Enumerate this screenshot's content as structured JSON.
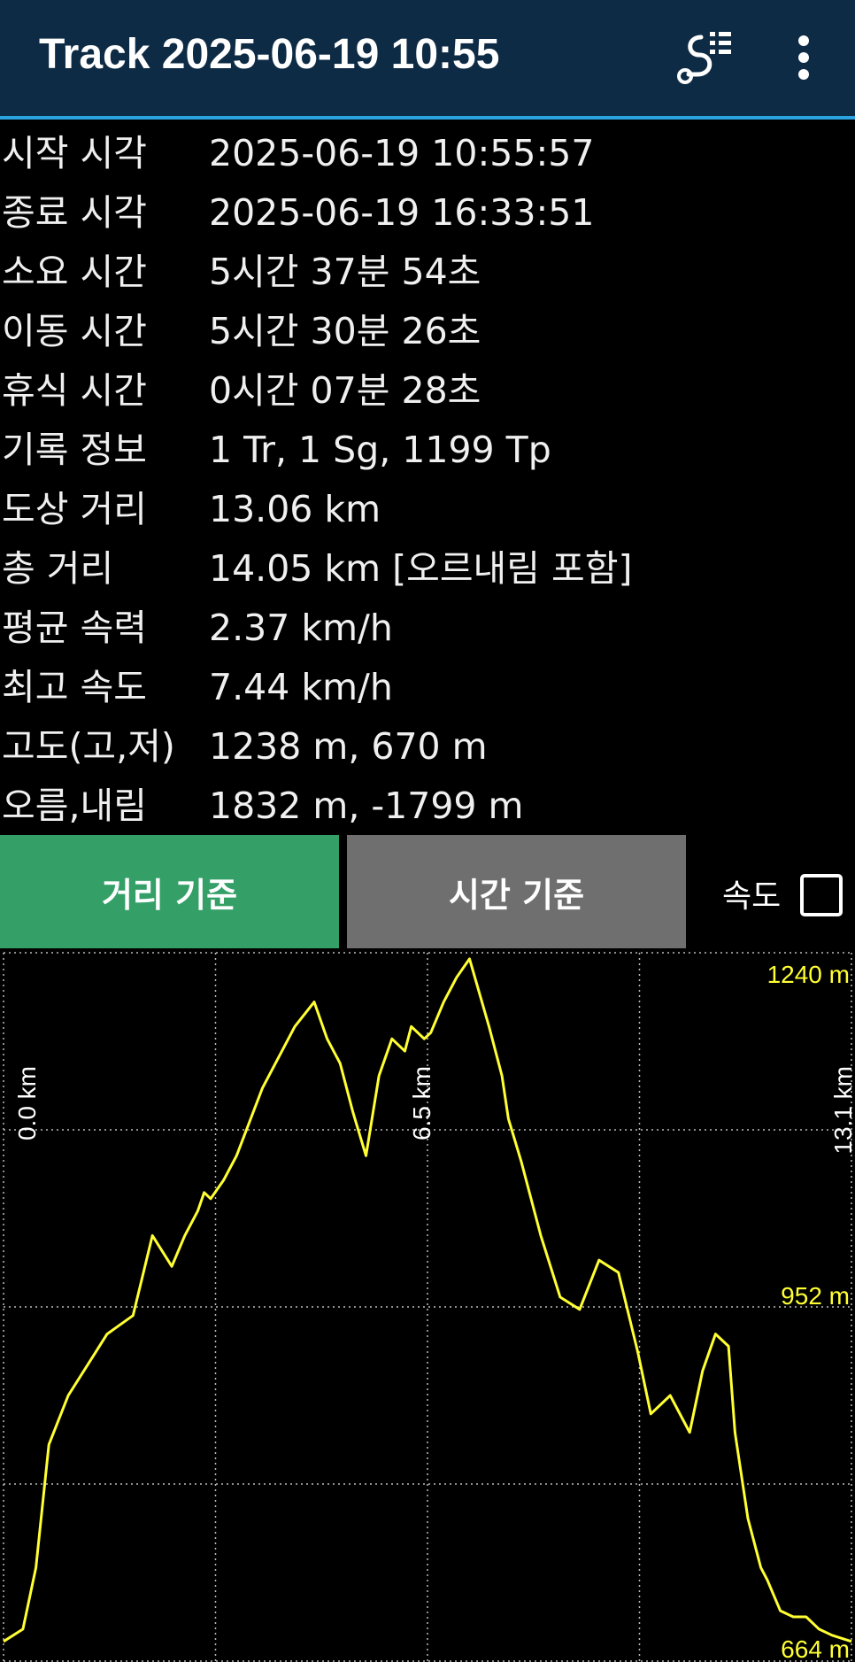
{
  "appbar": {
    "title": "Track 2025-06-19 10:55",
    "route_icon": "route-list-icon",
    "menu_icon": "more-vert-icon"
  },
  "info_rows": [
    {
      "label": "시작 시각",
      "value": "2025-06-19 10:55:57"
    },
    {
      "label": "종료 시각",
      "value": "2025-06-19 16:33:51"
    },
    {
      "label": "소요 시간",
      "value": "5시간 37분 54초"
    },
    {
      "label": "이동 시간",
      "value": "5시간 30분 26초"
    },
    {
      "label": "휴식 시간",
      "value": "0시간 07분 28초"
    },
    {
      "label": "기록 정보",
      "value": "1 Tr, 1 Sg, 1199 Tp"
    },
    {
      "label": "도상 거리",
      "value": "13.06 km"
    },
    {
      "label": "총 거리",
      "value": "14.05 km [오르내림 포함]"
    },
    {
      "label": "평균 속력",
      "value": "2.37 km/h"
    },
    {
      "label": "최고 속도",
      "value": "7.44 km/h"
    },
    {
      "label": "고도(고,저)",
      "value": "1238 m, 670 m"
    },
    {
      "label": "오름,내림",
      "value": "1832 m, -1799 m"
    }
  ],
  "buttons": {
    "distance_label": "거리 기준",
    "time_label": "시간 기준",
    "speed_label": "속도",
    "speed_checked": false
  },
  "colors": {
    "appbar_bg": "#0e2b45",
    "appbar_accent": "#2aa3e0",
    "active_button": "#34a068",
    "inactive_button": "#6f6f6f",
    "line": "#ffff33"
  },
  "chart_data": {
    "type": "line",
    "xlabel": "",
    "ylabel": "",
    "x_labels": [
      "0.0 km",
      "6.5 km",
      "13.1 km"
    ],
    "y_labels": [
      "1240 m",
      "952 m",
      "664 m"
    ],
    "xlim": [
      0,
      13.1
    ],
    "ylim": [
      664,
      1240
    ],
    "grid": true,
    "series": [
      {
        "x": [
          0,
          0.3,
          0.5,
          0.7,
          1.0,
          1.3,
          1.6,
          2.0,
          2.3,
          2.6,
          2.8,
          3.0,
          3.1,
          3.2,
          3.4,
          3.6,
          4.0,
          4.3,
          4.5,
          4.8,
          5.0,
          5.2,
          5.4,
          5.6,
          5.8,
          6.0,
          6.2,
          6.3,
          6.5,
          6.6,
          6.8,
          7.0,
          7.2,
          7.5,
          7.7,
          7.8,
          8.0,
          8.3,
          8.6,
          8.9,
          9.2,
          9.5,
          9.8,
          10.0,
          10.3,
          10.6,
          10.8,
          11.0,
          11.2,
          11.3,
          11.5,
          11.7,
          11.8,
          12.0,
          12.2,
          12.4,
          12.6,
          12.8,
          13.1
        ],
        "values": [
          680,
          690,
          740,
          840,
          880,
          905,
          930,
          945,
          1010,
          985,
          1010,
          1030,
          1045,
          1040,
          1055,
          1075,
          1130,
          1160,
          1180,
          1200,
          1170,
          1150,
          1110,
          1075,
          1140,
          1170,
          1160,
          1180,
          1170,
          1175,
          1200,
          1220,
          1235,
          1180,
          1140,
          1105,
          1070,
          1010,
          960,
          950,
          990,
          980,
          915,
          865,
          880,
          850,
          900,
          930,
          920,
          850,
          780,
          740,
          730,
          705,
          700,
          700,
          690,
          685,
          680
        ]
      }
    ]
  }
}
